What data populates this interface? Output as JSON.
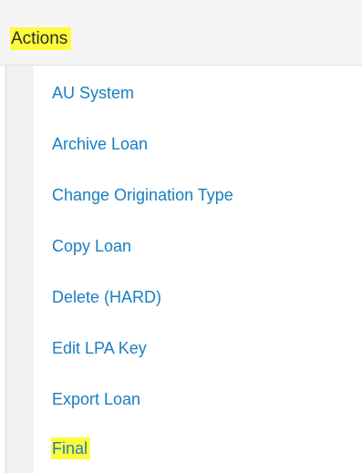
{
  "header": {
    "title": "Actions"
  },
  "menu": {
    "items": [
      {
        "label": "AU System"
      },
      {
        "label": "Archive Loan"
      },
      {
        "label": "Change Origination Type"
      },
      {
        "label": "Copy Loan"
      },
      {
        "label": "Delete (HARD)"
      },
      {
        "label": "Edit LPA Key"
      },
      {
        "label": "Export Loan"
      },
      {
        "label": "Final"
      }
    ]
  },
  "colors": {
    "link": "#1a7ec1",
    "highlight": "#fffb3b",
    "header_bg": "#f5f5f5",
    "text": "#2b2b2b"
  }
}
